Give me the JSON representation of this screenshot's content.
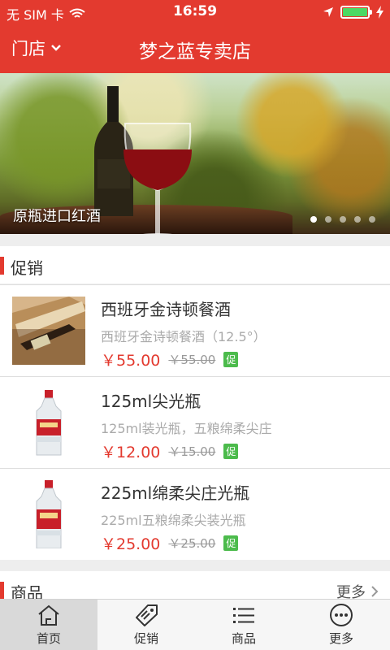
{
  "status_bar": {
    "carrier": "无 SIM 卡",
    "time": "16:59"
  },
  "header": {
    "store_label": "门店",
    "title": "梦之蓝专卖店"
  },
  "banner": {
    "caption": "原瓶进口红酒",
    "slides": 5,
    "active_slide": 0
  },
  "promo_section": {
    "label": "促销"
  },
  "products": [
    {
      "name": "西班牙金诗顿餐酒",
      "desc": "西班牙金诗顿餐酒（12.5°）",
      "price": "￥55.00",
      "old_price": "￥55.00",
      "badge": "促",
      "thumb": "wine-box"
    },
    {
      "name": "125ml尖光瓶",
      "desc": "125ml装光瓶，五粮绵柔尖庄",
      "price": "￥12.00",
      "old_price": "￥15.00",
      "badge": "促",
      "thumb": "baijiu-bottle"
    },
    {
      "name": "225ml绵柔尖庄光瓶",
      "desc": "225ml五粮绵柔尖装光瓶",
      "price": "￥25.00",
      "old_price": "￥25.00",
      "badge": "促",
      "thumb": "baijiu-bottle"
    }
  ],
  "goods_section": {
    "label": "商品",
    "more_label": "更多"
  },
  "tabbar": [
    {
      "label": "首页",
      "icon": "home-icon",
      "active": true
    },
    {
      "label": "促销",
      "icon": "tag-icon",
      "active": false
    },
    {
      "label": "商品",
      "icon": "list-icon",
      "active": false
    },
    {
      "label": "更多",
      "icon": "more-icon",
      "active": false
    }
  ],
  "colors": {
    "brand_red": "#e33a2f",
    "promo_green": "#4cbb4c",
    "battery_green": "#4cd964"
  }
}
